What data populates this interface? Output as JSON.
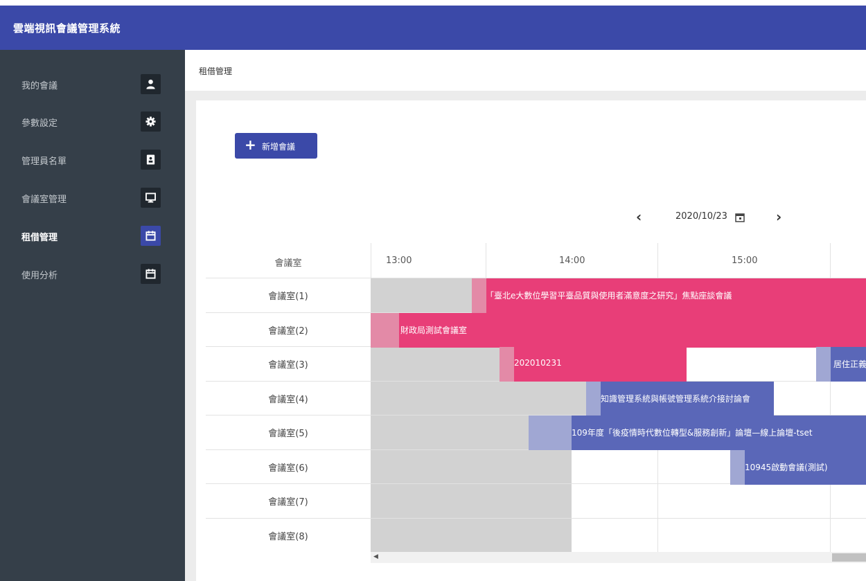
{
  "app": {
    "title": "雲端視訊會議管理系統"
  },
  "sidebar": {
    "items": [
      {
        "label": "我的會議",
        "icon": "user-icon",
        "active": false
      },
      {
        "label": "參數設定",
        "icon": "gear-icon",
        "active": false
      },
      {
        "label": "管理員名單",
        "icon": "contact-card-icon",
        "active": false
      },
      {
        "label": "會議室管理",
        "icon": "monitor-icon",
        "active": false
      },
      {
        "label": "租借管理",
        "icon": "calendar-icon",
        "active": true
      },
      {
        "label": "使用分析",
        "icon": "calendar-icon",
        "active": false
      }
    ]
  },
  "breadcrumb": "租借管理",
  "toolbar": {
    "add_label": "新增會議"
  },
  "date_nav": {
    "date": "2020/10/23"
  },
  "schedule": {
    "room_header": "會議室",
    "times": [
      "13:00",
      "14:00",
      "15:00"
    ],
    "rooms": [
      "會議室(1)",
      "會議室(2)",
      "會議室(3)",
      "會議室(4)",
      "會議室(5)",
      "會議室(6)",
      "會議室(7)",
      "會議室(8)"
    ],
    "events": [
      {
        "room": 1,
        "start": "13:35",
        "title": "「臺北e大數位學習平臺品質與使用者滿意度之研究」焦點座談會議",
        "color": "pink"
      },
      {
        "room": 2,
        "start": "13:00",
        "title": "財政局測試會議室",
        "color": "pink"
      },
      {
        "room": 3,
        "start": "13:45",
        "end": "14:50",
        "title": "202010231",
        "color": "pink"
      },
      {
        "room": 3,
        "start": "15:55",
        "title": "居住正義",
        "color": "blue"
      },
      {
        "room": 4,
        "start": "14:15",
        "end": "15:40",
        "title": "知識管理系統與帳號管理系統介接討論會",
        "color": "blue"
      },
      {
        "room": 5,
        "start": "13:55",
        "title": "109年度「後疫情時代數位轉型&服務創新」論壇—線上論壇-tset",
        "color": "blue"
      },
      {
        "room": 6,
        "start": "15:25",
        "title": "10945啟動會議(測試)",
        "color": "blue"
      }
    ]
  }
}
